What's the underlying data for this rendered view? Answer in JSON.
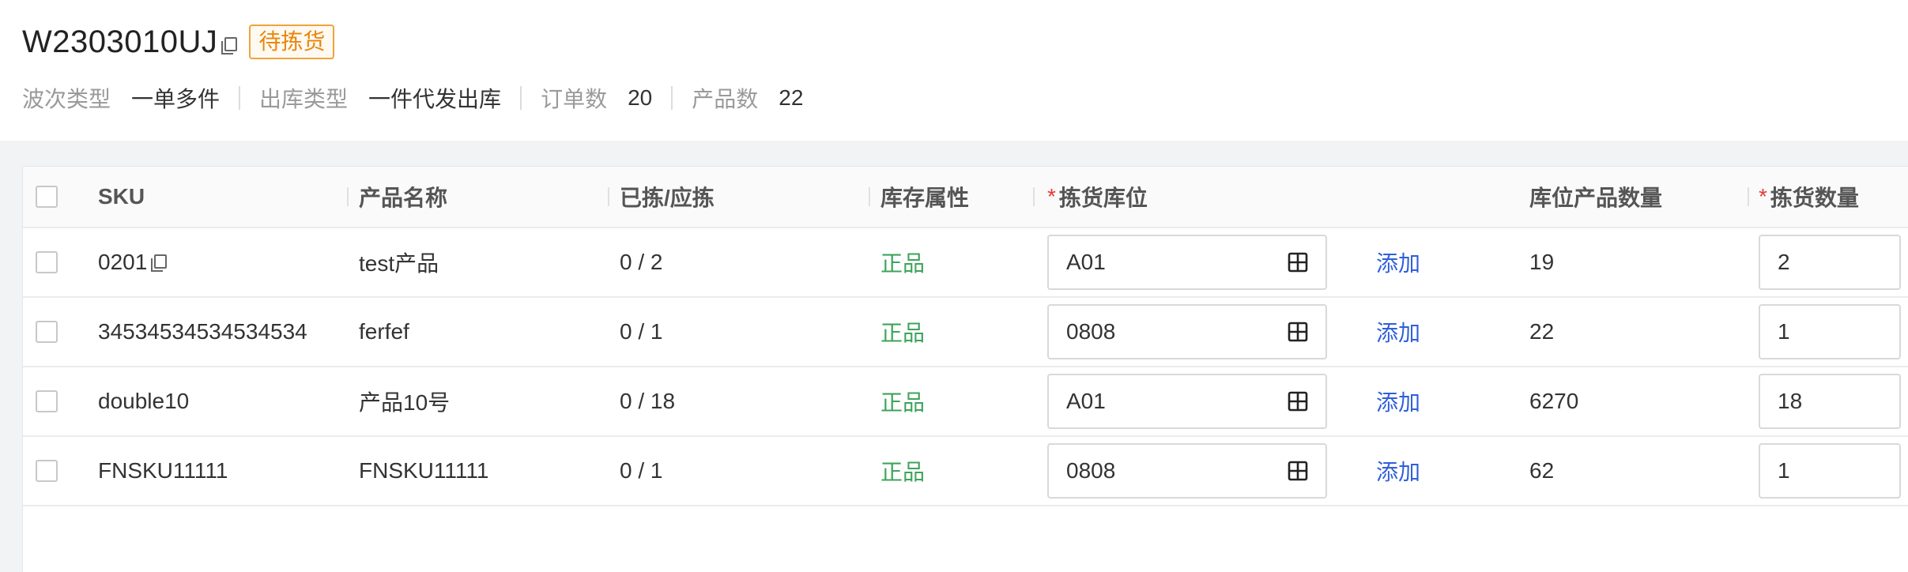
{
  "header": {
    "wave_no": "W2303010UJ",
    "status": "待拣货",
    "meta": [
      {
        "label": "波次类型",
        "value": "一单多件"
      },
      {
        "label": "出库类型",
        "value": "一件代发出库"
      },
      {
        "label": "订单数",
        "value": "20"
      },
      {
        "label": "产品数",
        "value": "22"
      }
    ]
  },
  "table": {
    "columns": {
      "sku": "SKU",
      "name": "产品名称",
      "picked": "已拣/应拣",
      "attr": "库存属性",
      "location": "拣货库位",
      "loc_qty": "库位产品数量",
      "pick_qty": "拣货数量",
      "required_mark": "*"
    },
    "add_label": "添加",
    "rows": [
      {
        "sku": "0201",
        "name": "test产品",
        "picked": "0 / 2",
        "attr": "正品",
        "location": "A01",
        "loc_qty": "19",
        "pick_qty": "2"
      },
      {
        "sku": "34534534534534534",
        "name": "ferfef",
        "picked": "0 / 1",
        "attr": "正品",
        "location": "0808",
        "loc_qty": "22",
        "pick_qty": "1"
      },
      {
        "sku": "double10",
        "name": "产品10号",
        "picked": "0 / 18",
        "attr": "正品",
        "location": "A01",
        "loc_qty": "6270",
        "pick_qty": "18"
      },
      {
        "sku": "FNSKU11111",
        "name": "FNSKU11111",
        "picked": "0 / 1",
        "attr": "正品",
        "location": "0808",
        "loc_qty": "62",
        "pick_qty": "1"
      }
    ]
  },
  "colors": {
    "status_border": "#f0a33a",
    "status_text": "#e8870f",
    "attr_green": "#3da45a",
    "link_blue": "#2f5fd9",
    "required_red": "#e53935"
  },
  "icons": {
    "copy": "copy-icon",
    "location_picker": "grid-icon"
  }
}
